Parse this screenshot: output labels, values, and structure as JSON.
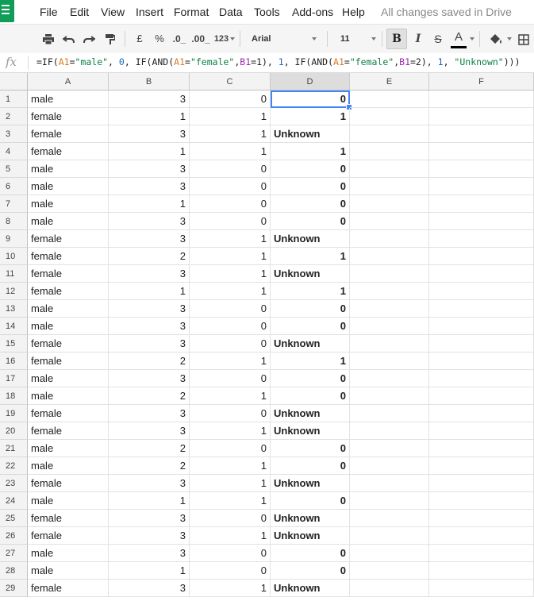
{
  "menu": {
    "items": [
      "File",
      "Edit",
      "View",
      "Insert",
      "Format",
      "Data",
      "Tools",
      "Add-ons",
      "Help"
    ],
    "save_status": "All changes saved in Drive"
  },
  "toolbar": {
    "currency": "£",
    "percent": "%",
    "decrease_decimals": ".0_",
    "increase_decimals": ".00_",
    "more_formats": "123",
    "font": "Arial",
    "font_size": "11",
    "bold": "B",
    "italic": "I",
    "strikethrough": "S",
    "text_color": "A"
  },
  "formula_bar": {
    "fx_label": "fx",
    "parts": [
      {
        "t": "=IF(",
        "c": ""
      },
      {
        "t": "A1",
        "c": "f-ref1"
      },
      {
        "t": "=",
        "c": ""
      },
      {
        "t": "\"male\"",
        "c": "f-str"
      },
      {
        "t": ", ",
        "c": ""
      },
      {
        "t": "0",
        "c": "f-num"
      },
      {
        "t": ", IF(AND(",
        "c": ""
      },
      {
        "t": "A1",
        "c": "f-ref1"
      },
      {
        "t": "=",
        "c": ""
      },
      {
        "t": "\"female\"",
        "c": "f-str"
      },
      {
        "t": ",",
        "c": ""
      },
      {
        "t": "B1",
        "c": "f-ref2"
      },
      {
        "t": "=1), ",
        "c": ""
      },
      {
        "t": "1",
        "c": "f-num"
      },
      {
        "t": ", IF(AND(",
        "c": ""
      },
      {
        "t": "A1",
        "c": "f-ref1"
      },
      {
        "t": "=",
        "c": ""
      },
      {
        "t": "\"female\"",
        "c": "f-str"
      },
      {
        "t": ",",
        "c": ""
      },
      {
        "t": "B1",
        "c": "f-ref2"
      },
      {
        "t": "=2), ",
        "c": ""
      },
      {
        "t": "1",
        "c": "f-num"
      },
      {
        "t": ", ",
        "c": ""
      },
      {
        "t": "\"Unknown\"",
        "c": "f-str"
      },
      {
        "t": ")))",
        "c": ""
      }
    ]
  },
  "grid": {
    "columns": [
      "A",
      "B",
      "C",
      "D",
      "E",
      "F"
    ],
    "selected_column": "D",
    "selected_cell": "D1",
    "rows": [
      [
        "male",
        "3",
        "0",
        "0"
      ],
      [
        "female",
        "1",
        "1",
        "1"
      ],
      [
        "female",
        "3",
        "1",
        "Unknown"
      ],
      [
        "female",
        "1",
        "1",
        "1"
      ],
      [
        "male",
        "3",
        "0",
        "0"
      ],
      [
        "male",
        "3",
        "0",
        "0"
      ],
      [
        "male",
        "1",
        "0",
        "0"
      ],
      [
        "male",
        "3",
        "0",
        "0"
      ],
      [
        "female",
        "3",
        "1",
        "Unknown"
      ],
      [
        "female",
        "2",
        "1",
        "1"
      ],
      [
        "female",
        "3",
        "1",
        "Unknown"
      ],
      [
        "female",
        "1",
        "1",
        "1"
      ],
      [
        "male",
        "3",
        "0",
        "0"
      ],
      [
        "male",
        "3",
        "0",
        "0"
      ],
      [
        "female",
        "3",
        "0",
        "Unknown"
      ],
      [
        "female",
        "2",
        "1",
        "1"
      ],
      [
        "male",
        "3",
        "0",
        "0"
      ],
      [
        "male",
        "2",
        "1",
        "0"
      ],
      [
        "female",
        "3",
        "0",
        "Unknown"
      ],
      [
        "female",
        "3",
        "1",
        "Unknown"
      ],
      [
        "male",
        "2",
        "0",
        "0"
      ],
      [
        "male",
        "2",
        "1",
        "0"
      ],
      [
        "female",
        "3",
        "1",
        "Unknown"
      ],
      [
        "male",
        "1",
        "1",
        "0"
      ],
      [
        "female",
        "3",
        "0",
        "Unknown"
      ],
      [
        "female",
        "3",
        "1",
        "Unknown"
      ],
      [
        "male",
        "3",
        "0",
        "0"
      ],
      [
        "male",
        "1",
        "0",
        "0"
      ],
      [
        "female",
        "3",
        "1",
        "Unknown"
      ]
    ]
  },
  "colors": {
    "selection": "#4285f4",
    "sheets_green": "#0f9d58"
  }
}
